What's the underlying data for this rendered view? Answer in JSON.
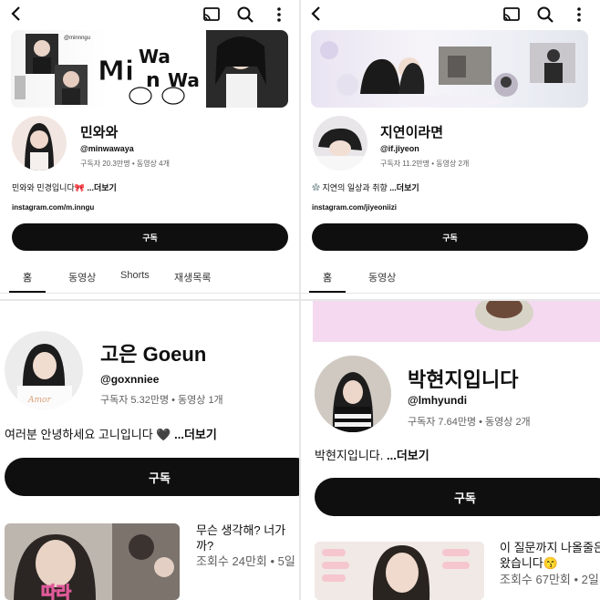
{
  "panel1": {
    "banner_text": "Minwawa",
    "banner_tag": "@minnngu",
    "channel_name": "민와와",
    "handle": "@minwawaya",
    "stats": "구독자 20.3만명 • 동영상 4개",
    "description": "민와와 민경입니다🎀",
    "more": "...더보기",
    "link": "instagram.com/m.inngu",
    "subscribe": "구독",
    "tabs": [
      "홈",
      "동영상",
      "Shorts",
      "재생목록"
    ]
  },
  "panel2": {
    "channel_name": "지연이라면",
    "handle": "@if.jiyeon",
    "stats": "구독자 11.2만명 • 동영상 2개",
    "description": "지연의 일상과 취향",
    "more": "...더보기",
    "link": "instagram.com/jiyeoniizi",
    "subscribe": "구독",
    "tabs": [
      "홈",
      "동영상"
    ]
  },
  "panel3": {
    "channel_name": "고은 Goeun",
    "handle": "@goxnniee",
    "stats": "구독자 5.32만명 • 동영상 1개",
    "description": "여러분 안녕하세요 고니입니다 🖤",
    "more": "...더보기",
    "subscribe": "구독",
    "video_title_line1": "무슨 생각해? 너가 ",
    "video_title_line2": "까?",
    "video_meta": "조회수 24만회 • 5일"
  },
  "panel4": {
    "channel_name": "박현지입니다",
    "handle": "@lmhyundi",
    "stats": "구독자 7.64만명 • 동영상 2개",
    "description": "박현지입니다.",
    "more": "...더보기",
    "subscribe": "구독",
    "video_title_line1": "이 질문까지 나올줄은",
    "video_title_line2": "왔습니다😙",
    "video_meta": "조회수 67만회 • 2일"
  },
  "icons": [
    "back-arrow-icon",
    "cast-icon",
    "search-icon",
    "more-vert-icon"
  ],
  "colors": {
    "button": "#0f0f0f",
    "banner_pink": "#f4d9f0"
  }
}
